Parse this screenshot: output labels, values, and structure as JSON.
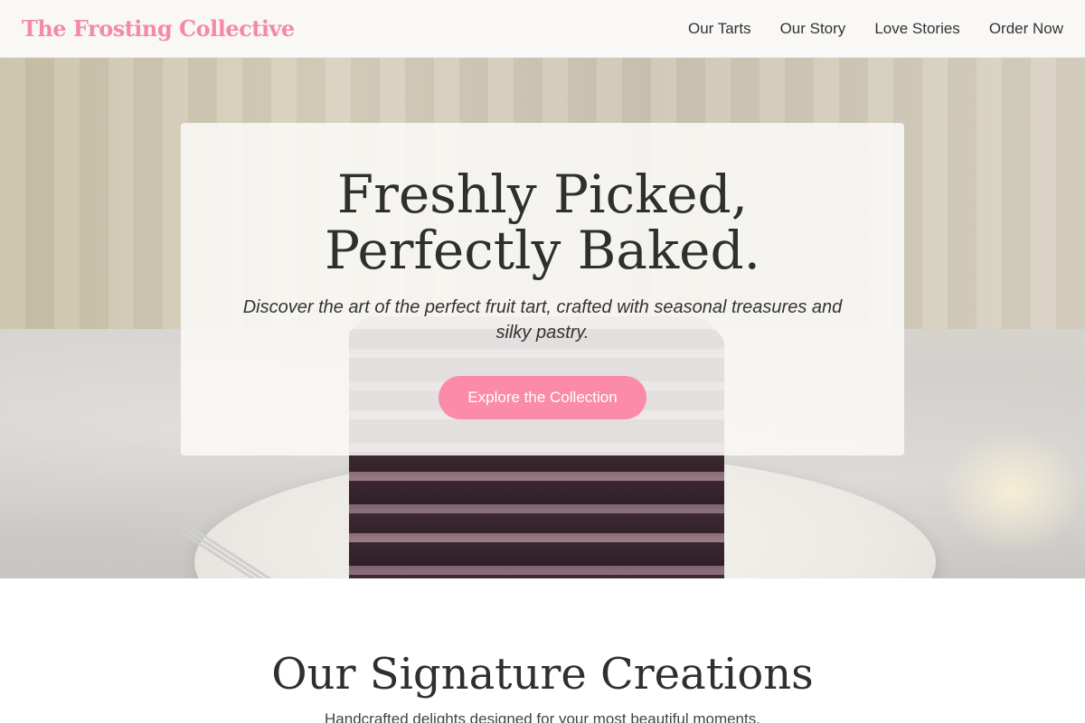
{
  "header": {
    "brand": "The Frosting Collective",
    "nav": [
      {
        "label": "Our Tarts"
      },
      {
        "label": "Our Story"
      },
      {
        "label": "Love Stories"
      },
      {
        "label": "Order Now"
      }
    ]
  },
  "hero": {
    "title": "Freshly Picked, Perfectly Baked.",
    "subtitle": "Discover the art of the perfect fruit tart, crafted with seasonal treasures and silky pastry.",
    "cta_label": "Explore the Collection"
  },
  "signature": {
    "title": "Our Signature Creations",
    "subtitle": "Handcrafted delights designed for your most beautiful moments."
  },
  "colors": {
    "brand_pink": "#f48aa6",
    "button_pink": "#fb8ba8",
    "heading_text": "#2f2f2f"
  }
}
